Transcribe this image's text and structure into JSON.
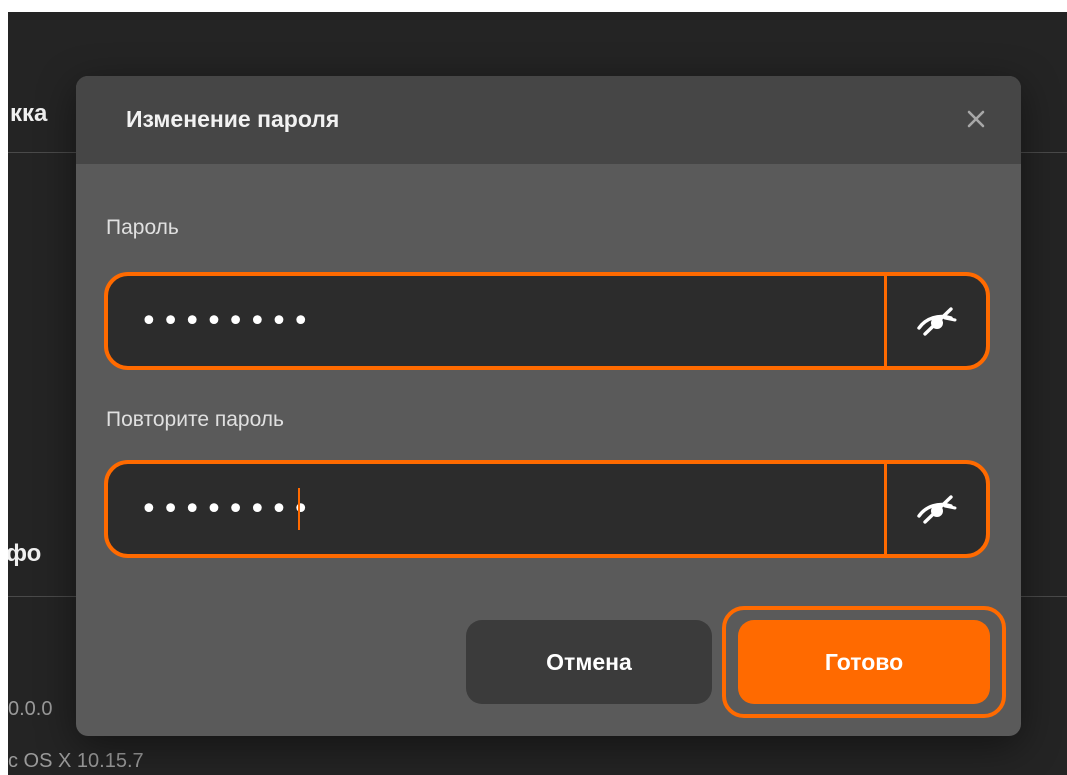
{
  "background": {
    "heading_1": "кка",
    "heading_2": "фо",
    "line_1": "0.0.0",
    "line_2": "c OS X 10.15.7"
  },
  "modal": {
    "title": "Изменение пароля",
    "close_icon": "close-icon"
  },
  "password_field": {
    "label": "Пароль",
    "value": "••••••••",
    "toggle_icon": "eye-slash-icon"
  },
  "repeat_password_field": {
    "label": "Повторите пароль",
    "value": "••••••••",
    "toggle_icon": "eye-slash-icon"
  },
  "buttons": {
    "cancel_label": "Отмена",
    "done_label": "Готово"
  },
  "colors": {
    "accent": "#ff6a00",
    "modal_bg": "#5a5a5a",
    "header_bg": "#464646",
    "input_bg": "#2c2c2c",
    "app_bg": "#242424"
  }
}
